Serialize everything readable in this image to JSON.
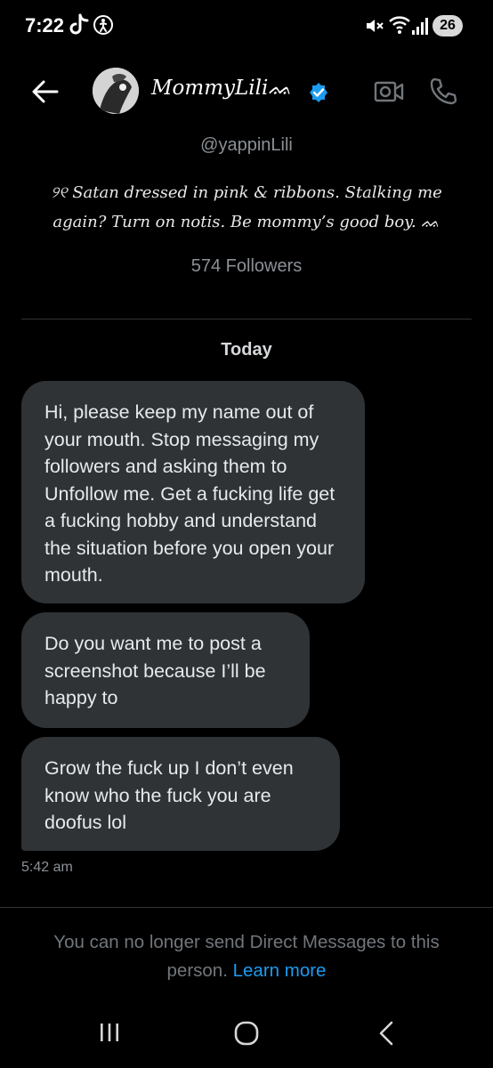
{
  "status_bar": {
    "time": "7:22",
    "battery": "26",
    "icons": [
      "tiktok-icon",
      "accessibility-icon",
      "mute-icon",
      "wifi-icon",
      "signal-icon"
    ]
  },
  "header": {
    "display_name": "MommyLili",
    "name_suffix": "ᨐ",
    "verified": true,
    "icons": [
      "back-arrow-icon",
      "video-call-icon",
      "phone-call-icon"
    ]
  },
  "profile": {
    "handle": "@yappinLili",
    "bio_line_1": "୨୧ Satan dressed in pink & ribbons. Stalking me",
    "bio_line_2": "again? Turn on notis. Be mommy’s good boy. ᨐ",
    "followers": "574 Followers"
  },
  "conversation": {
    "day_label": "Today",
    "messages": [
      {
        "text": "Hi, please keep my name out of your mouth. Stop messaging my followers and asking them to Unfollow me. Get a fucking life get a fucking hobby and understand the situation before you open your mouth."
      },
      {
        "text": "Do you want me to post a screenshot because I’ll be happy to"
      },
      {
        "text": "Grow the fuck up I don’t even know who the fuck you are doofus lol"
      }
    ],
    "last_time": "5:42 am"
  },
  "footer": {
    "notice_text": "You can no longer send Direct Messages to this person.",
    "learn_more": "Learn more"
  },
  "colors": {
    "background": "#000000",
    "bubble": "#2f3336",
    "accent": "#1d9bf0",
    "muted": "#71767b"
  }
}
